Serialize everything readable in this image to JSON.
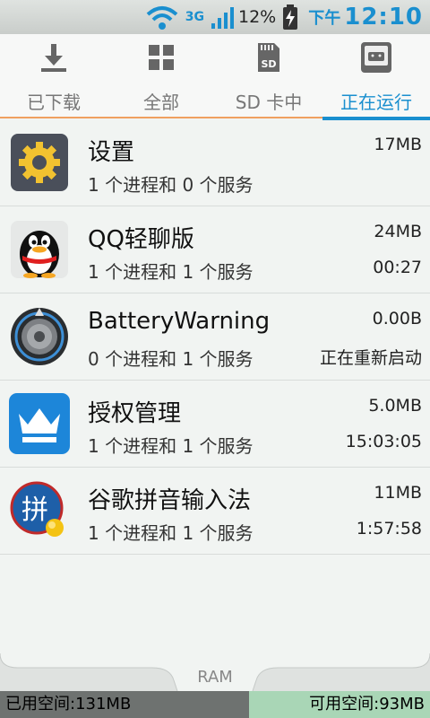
{
  "status": {
    "network": "3G",
    "battery": "12%",
    "time_prefix": "下午",
    "time": "12:10"
  },
  "tabs": [
    {
      "label": "已下载",
      "icon": "download-icon"
    },
    {
      "label": "全部",
      "icon": "grid-icon"
    },
    {
      "label": "SD 卡中",
      "icon": "sd-card-icon"
    },
    {
      "label": "正在运行",
      "icon": "running-icon",
      "active": true
    }
  ],
  "apps": [
    {
      "name": "设置",
      "sub": "1 个进程和 0 个服务",
      "size": "17MB",
      "time": "",
      "icon": "settings-gear-icon"
    },
    {
      "name": "QQ轻聊版",
      "sub": "1 个进程和 1 个服务",
      "size": "24MB",
      "time": "00:27",
      "icon": "qq-penguin-icon"
    },
    {
      "name": "BatteryWarning",
      "sub": "0 个进程和 1 个服务",
      "size": "0.00B",
      "time": "正在重新启动",
      "icon": "battery-warning-icon"
    },
    {
      "name": "授权管理",
      "sub": "1 个进程和 1 个服务",
      "size": "5.0MB",
      "time": "15:03:05",
      "icon": "crown-icon"
    },
    {
      "name": "谷歌拼音输入法",
      "sub": "1 个进程和 1 个服务",
      "size": "11MB",
      "time": "1:57:58",
      "icon": "pinyin-input-icon"
    }
  ],
  "ram": {
    "label": "RAM",
    "used": "已用空间:131MB",
    "free": "可用空间:93MB"
  },
  "colors": {
    "accent": "#1a8fcf",
    "tab_underline": "#f0a060"
  }
}
